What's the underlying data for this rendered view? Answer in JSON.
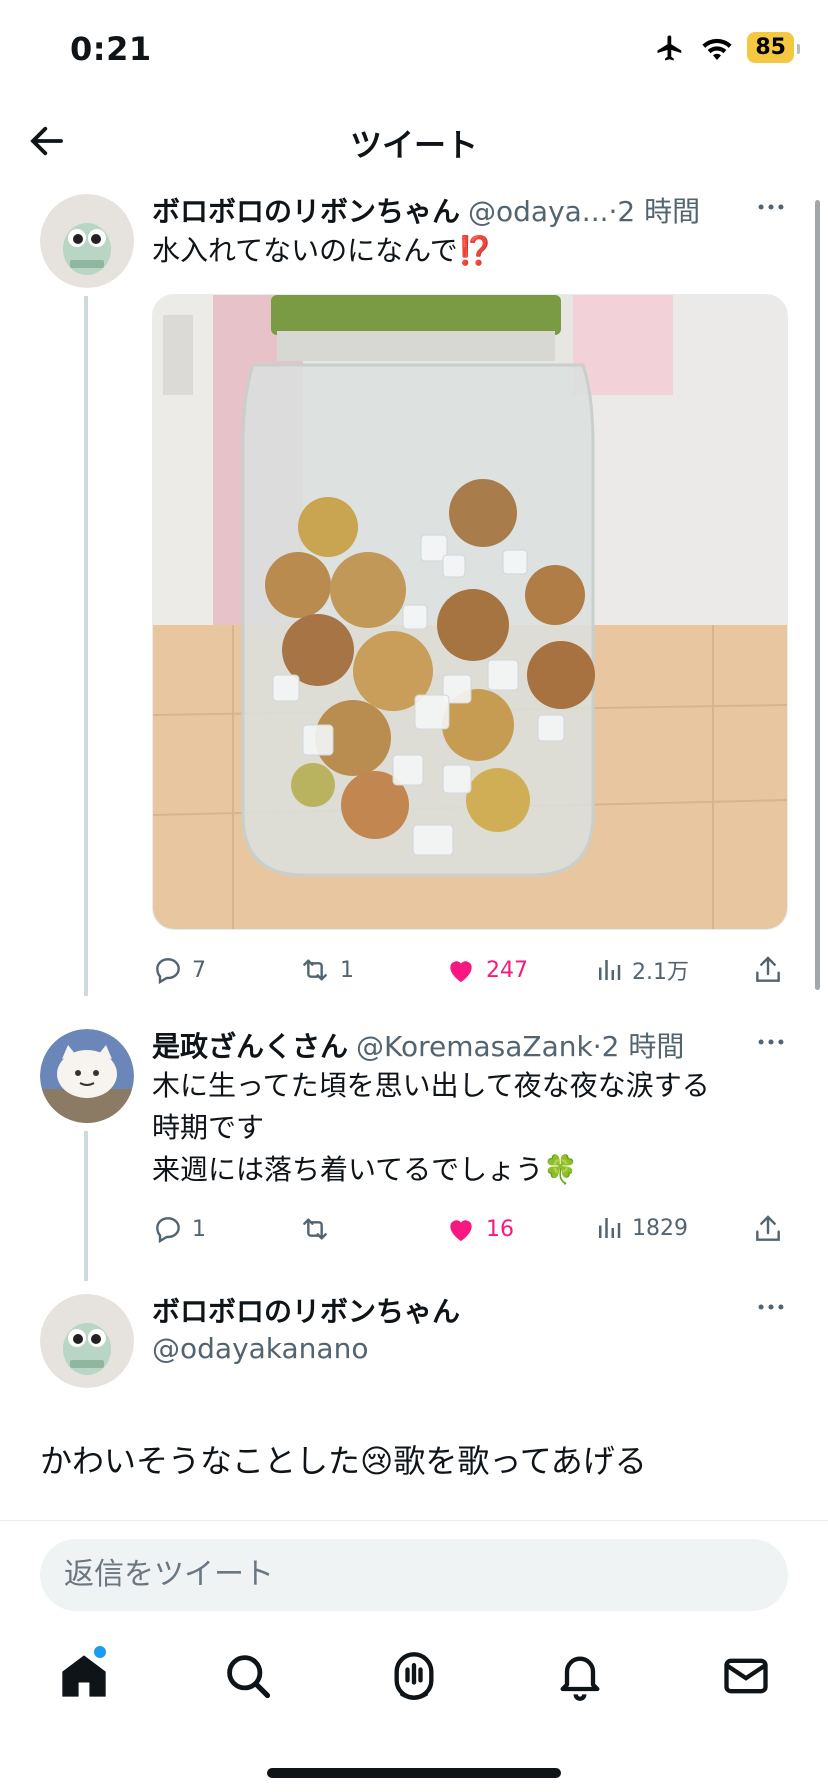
{
  "status": {
    "time": "0:21",
    "battery": "85"
  },
  "header": {
    "title": "ツイート"
  },
  "tweets": [
    {
      "name": "ボロボロのリボンちゃん",
      "handle": "@odaya...",
      "dot": " · ",
      "when": "2 時間",
      "text": "水入れてないのになんで⁉️",
      "stats": {
        "replies": "7",
        "retweets": "1",
        "likes": "247",
        "views": "2.1万"
      }
    },
    {
      "name": "是政ざんくさん",
      "handle": "@KoremasaZank",
      "dot": " · ",
      "when": "2 時間",
      "text_lines": [
        "木に生ってた頃を思い出して夜な夜な涙する",
        "時期です",
        "来週には落ち着いてるでしょう🍀"
      ],
      "stats": {
        "replies": "1",
        "retweets": "",
        "likes": "16",
        "views": "1829"
      }
    },
    {
      "name": "ボロボロのリボンちゃん",
      "handle": "@odayakanano",
      "text": "かわいそうなことした😢歌を歌ってあげる"
    }
  ],
  "reply": {
    "placeholder": "返信をツイート"
  },
  "colors": {
    "like": "#f91880",
    "accent": "#1d9bf0",
    "muted": "#536471"
  },
  "icons": [
    "back-arrow-icon",
    "airplane-icon",
    "wifi-icon",
    "more-icon",
    "reply-icon",
    "retweet-icon",
    "heart-icon",
    "views-icon",
    "share-icon",
    "home-icon",
    "search-icon",
    "spaces-icon",
    "bell-icon",
    "mail-icon"
  ]
}
